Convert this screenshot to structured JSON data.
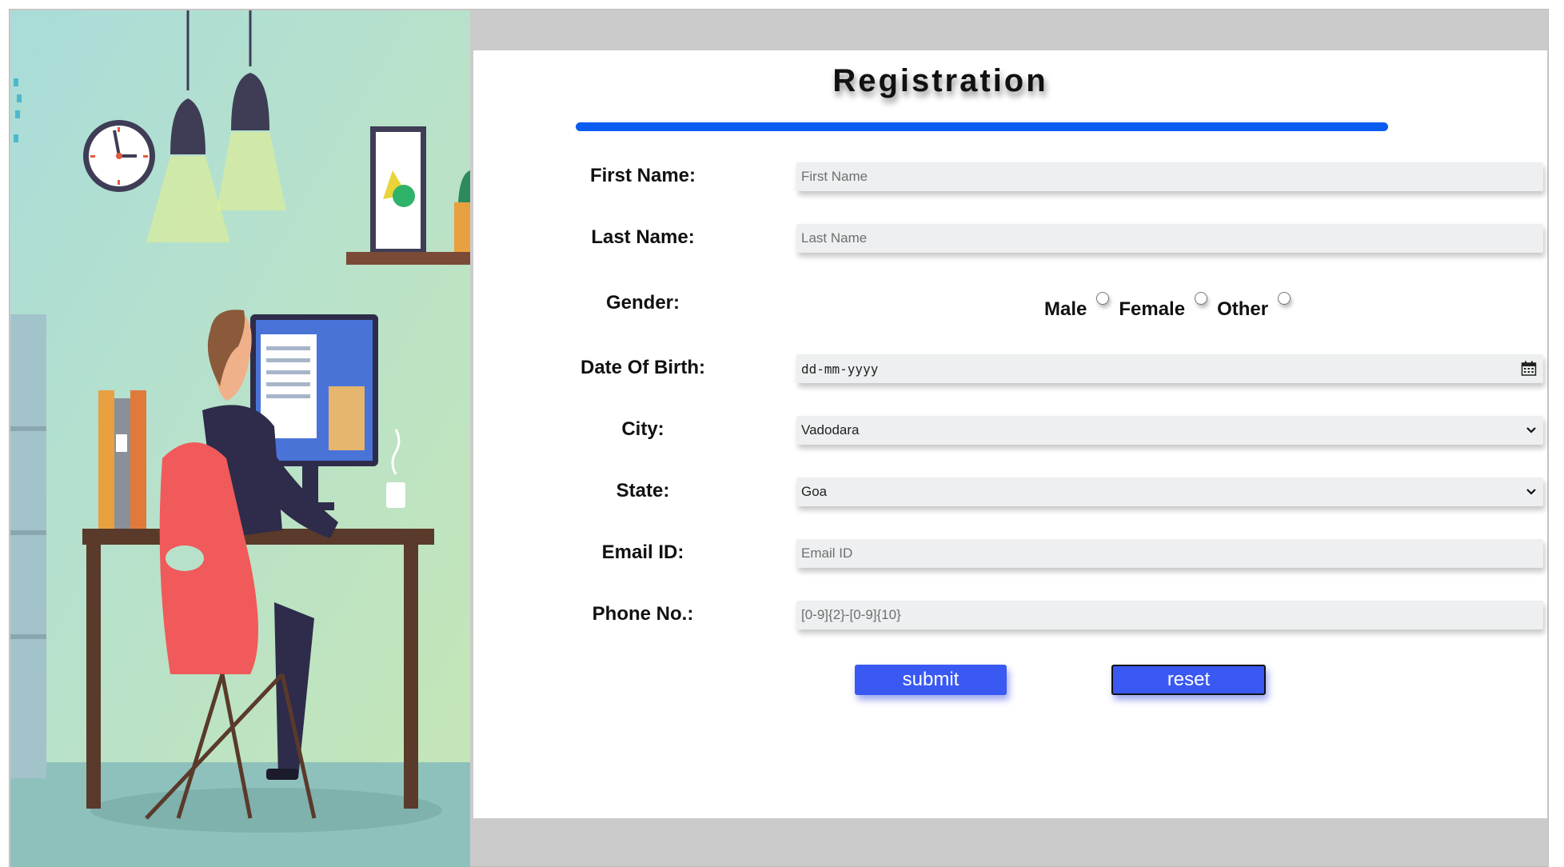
{
  "page": {
    "title": "Registration",
    "accent_color": "#0b5cf0",
    "button_color": "#3a59f2"
  },
  "form": {
    "first_name": {
      "label": "First Name:",
      "placeholder": "First Name"
    },
    "last_name": {
      "label": "Last Name:",
      "placeholder": "Last Name"
    },
    "gender": {
      "label": "Gender:",
      "options": [
        "Male",
        "Female",
        "Other"
      ]
    },
    "dob": {
      "label": "Date Of Birth:",
      "placeholder": "dd-mm-yyyy",
      "icon": "calendar-icon"
    },
    "city": {
      "label": "City:",
      "selected": "Vadodara",
      "icon": "chevron-down-icon"
    },
    "state": {
      "label": "State:",
      "selected": "Goa",
      "icon": "chevron-down-icon"
    },
    "email": {
      "label": "Email ID:",
      "placeholder": "Email ID"
    },
    "phone": {
      "label": "Phone No.:",
      "placeholder": "[0-9]{2}-[0-9]{10}"
    }
  },
  "buttons": {
    "submit": "submit",
    "reset": "reset"
  },
  "illustration": {
    "description_icon": "office-worker-illustration"
  }
}
